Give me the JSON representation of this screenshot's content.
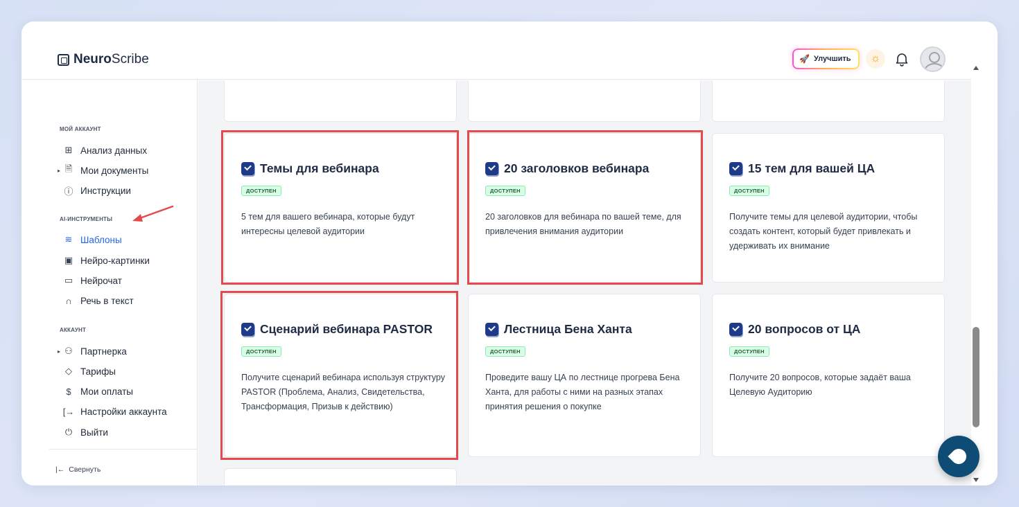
{
  "brand": {
    "bold": "Neuro",
    "light": "Scribe"
  },
  "header": {
    "upgrade_label": "Улучшить"
  },
  "sidebar": {
    "section_account": "МОЙ АККАУНТ",
    "section_ai": "AI-ИНСТРУМЕНТЫ",
    "section_acc": "АККАУНТ",
    "items": [
      {
        "label": "Анализ данных",
        "icon": "grid-icon"
      },
      {
        "label": "Мои документы",
        "icon": "document-icon"
      },
      {
        "label": "Инструкции",
        "icon": "help-icon"
      },
      {
        "label": "Шаблоны",
        "icon": "layers-icon"
      },
      {
        "label": "Нейро-картинки",
        "icon": "image-icon"
      },
      {
        "label": "Нейрочат",
        "icon": "chat-icon"
      },
      {
        "label": "Речь в текст",
        "icon": "headphones-icon"
      },
      {
        "label": "Партнерка",
        "icon": "users-icon"
      },
      {
        "label": "Тарифы",
        "icon": "tag-icon"
      },
      {
        "label": "Мои оплаты",
        "icon": "dollar-icon"
      },
      {
        "label": "Настройки аккаунта",
        "icon": "login-icon"
      },
      {
        "label": "Выйти",
        "icon": "power-icon"
      }
    ],
    "collapse_label": "Свернуть"
  },
  "cards": [
    {
      "title": "Темы для вебинара",
      "badge": "ДОСТУПЕН",
      "desc": "5 тем для вашего вебинара, которые будут интересны целевой аудитории"
    },
    {
      "title": "20 заголовков вебинара",
      "badge": "ДОСТУПЕН",
      "desc": "20 заголовков для вебинара по вашей теме, для привлечения внимания аудитории"
    },
    {
      "title": "15 тем для вашей ЦА",
      "badge": "ДОСТУПЕН",
      "desc": "Получите темы для целевой аудитории, чтобы создать контент, который будет привлекать и удерживать их внимание"
    },
    {
      "title": "Сценарий вебинара PASTOR",
      "badge": "ДОСТУПЕН",
      "desc": "Получите сценарий вебинара используя структуру PASTOR (Проблема, Анализ, Свидетельства, Трансформация, Призыв к действию)"
    },
    {
      "title": "Лестница Бена Ханта",
      "badge": "ДОСТУПЕН",
      "desc": "Проведите вашу ЦА по лестнице прогрева Бена Ханта, для работы с ними на разных этапах принятия решения о покупке"
    },
    {
      "title": "20 вопросов от ЦА",
      "badge": "ДОСТУПЕН",
      "desc": "Получите 20 вопросов, которые задаёт ваша Целевую Аудиторию"
    }
  ],
  "colors": {
    "accent": "#2563eb",
    "highlight": "#e5484d",
    "badge_bg": "#dcfce7",
    "fab": "#0f4c75"
  }
}
